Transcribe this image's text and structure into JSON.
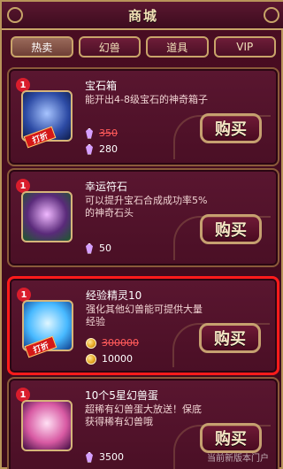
{
  "header": {
    "title": "商城"
  },
  "tabs": [
    {
      "label": "热卖",
      "active": true
    },
    {
      "label": "幻兽",
      "active": false
    },
    {
      "label": "道具",
      "active": false
    },
    {
      "label": "VIP",
      "active": false
    }
  ],
  "items": [
    {
      "badge": "1",
      "name": "宝石箱",
      "desc": "能开出4-8级宝石的神奇箱子",
      "discount_label": "打折",
      "price_currency_icon": "gem-icon",
      "old_price": "350",
      "price": "280",
      "buy_label": "购买"
    },
    {
      "badge": "1",
      "name": "幸运符石",
      "desc": "可以提升宝石合成成功率5%的神奇石头",
      "price_currency_icon": "gem-icon",
      "price": "50",
      "buy_label": "购买"
    },
    {
      "badge": "1",
      "name": "经验精灵10",
      "desc": "强化其他幻兽能可提供大量经验",
      "discount_label": "打折",
      "price_currency_icon": "coin-icon",
      "old_price": "300000",
      "price": "10000",
      "buy_label": "购买"
    },
    {
      "badge": "1",
      "name": "10个5星幻兽蛋",
      "desc": "超稀有幻兽蛋大放送！保底获得稀有幻兽哦",
      "price_currency_icon": "gem-icon",
      "price": "3500",
      "buy_label": "购买"
    }
  ],
  "watermark": "当前新版本门户"
}
